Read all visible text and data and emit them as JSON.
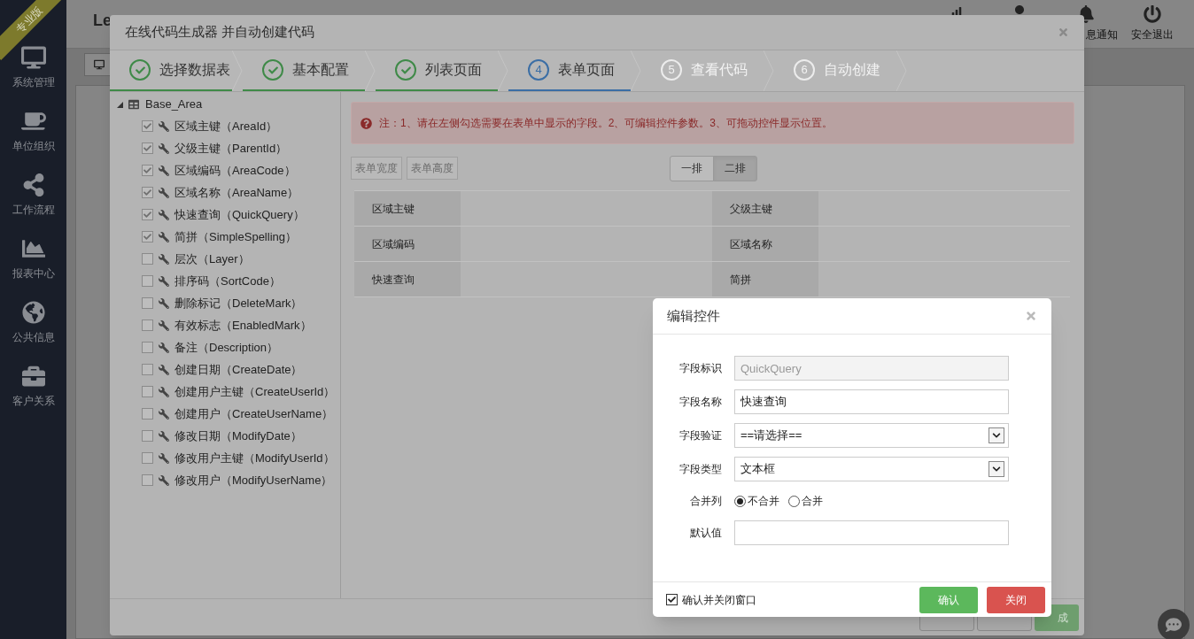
{
  "sidebar": {
    "badge": "专业版",
    "items": [
      {
        "label": "系统管理"
      },
      {
        "label": "单位组织"
      },
      {
        "label": "工作流程"
      },
      {
        "label": "报表中心"
      },
      {
        "label": "公共信息"
      },
      {
        "label": "客户关系"
      }
    ]
  },
  "header": {
    "title": "Le",
    "actions": [
      {
        "kind": "chart"
      },
      {
        "kind": "user"
      },
      {
        "kind": "bell",
        "label": "息通知"
      },
      {
        "kind": "power",
        "label": "安全退出"
      }
    ]
  },
  "generator": {
    "title": "在线代码生成器 并自动创建代码",
    "steps": [
      {
        "completed": true,
        "selected": false,
        "label": "选择数据表"
      },
      {
        "completed": true,
        "selected": false,
        "label": "基本配置"
      },
      {
        "completed": true,
        "selected": false,
        "label": "列表页面"
      },
      {
        "completed": false,
        "selected": true,
        "number": "4",
        "label": "表单页面"
      },
      {
        "completed": false,
        "selected": false,
        "number": "5",
        "label": "查看代码"
      },
      {
        "completed": false,
        "selected": false,
        "number": "6",
        "label": "自动创建"
      }
    ],
    "tree": {
      "label": "Base_Area",
      "expanded": true,
      "children": [
        {
          "label": "区域主键（AreaId）",
          "checked": true
        },
        {
          "label": "父级主键（ParentId）",
          "checked": true
        },
        {
          "label": "区域编码（AreaCode）",
          "checked": true
        },
        {
          "label": "区域名称（AreaName）",
          "checked": true
        },
        {
          "label": "快速查询（QuickQuery）",
          "checked": true
        },
        {
          "label": "简拼（SimpleSpelling）",
          "checked": true
        },
        {
          "label": "层次（Layer）",
          "checked": false
        },
        {
          "label": "排序码（SortCode）",
          "checked": false
        },
        {
          "label": "删除标记（DeleteMark）",
          "checked": false
        },
        {
          "label": "有效标志（EnabledMark）",
          "checked": false
        },
        {
          "label": "备注（Description）",
          "checked": false
        },
        {
          "label": "创建日期（CreateDate）",
          "checked": false
        },
        {
          "label": "创建用户主键（CreateUserId）",
          "checked": false
        },
        {
          "label": "创建用户（CreateUserName）",
          "checked": false
        },
        {
          "label": "修改日期（ModifyDate）",
          "checked": false
        },
        {
          "label": "修改用户主键（ModifyUserId）",
          "checked": false
        },
        {
          "label": "修改用户（ModifyUserName）",
          "checked": false
        }
      ]
    },
    "notice": "注：1、请在左侧勾选需要在表单中显示的字段。2、可编辑控件参数。3、可拖动控件显示位置。",
    "size_buttons": [
      "表单宽度",
      "表单高度"
    ],
    "layout_options": [
      {
        "label": "一排",
        "selected": false
      },
      {
        "label": "二排",
        "selected": true
      }
    ],
    "form_fields": [
      "区域主键",
      "父级主键",
      "区域编码",
      "区域名称",
      "快速查询",
      "简拼"
    ],
    "footer_buttons": [
      {
        "kind": "default"
      },
      {
        "kind": "default"
      },
      {
        "kind": "primary",
        "label": "成"
      }
    ]
  },
  "edit_dialog": {
    "title": "编辑控件",
    "fields": [
      {
        "kind": "text",
        "label": "字段标识",
        "value": "QuickQuery",
        "disabled": true
      },
      {
        "kind": "text",
        "label": "字段名称",
        "value": "快速查询",
        "disabled": false
      },
      {
        "kind": "select",
        "label": "字段验证",
        "value": "==请选择=="
      },
      {
        "kind": "select",
        "label": "字段类型",
        "value": "文本框"
      },
      {
        "kind": "radio",
        "label": "合并列",
        "options": [
          {
            "label": "不合并",
            "selected": true
          },
          {
            "label": "合并",
            "selected": false
          }
        ]
      },
      {
        "kind": "text",
        "label": "默认值",
        "disabled": false
      }
    ],
    "close_after_confirm": {
      "label": "确认并关闭窗口",
      "checked": true
    },
    "buttons": [
      {
        "kind": "confirm",
        "label": "确认"
      },
      {
        "kind": "close",
        "label": "关闭"
      }
    ]
  }
}
